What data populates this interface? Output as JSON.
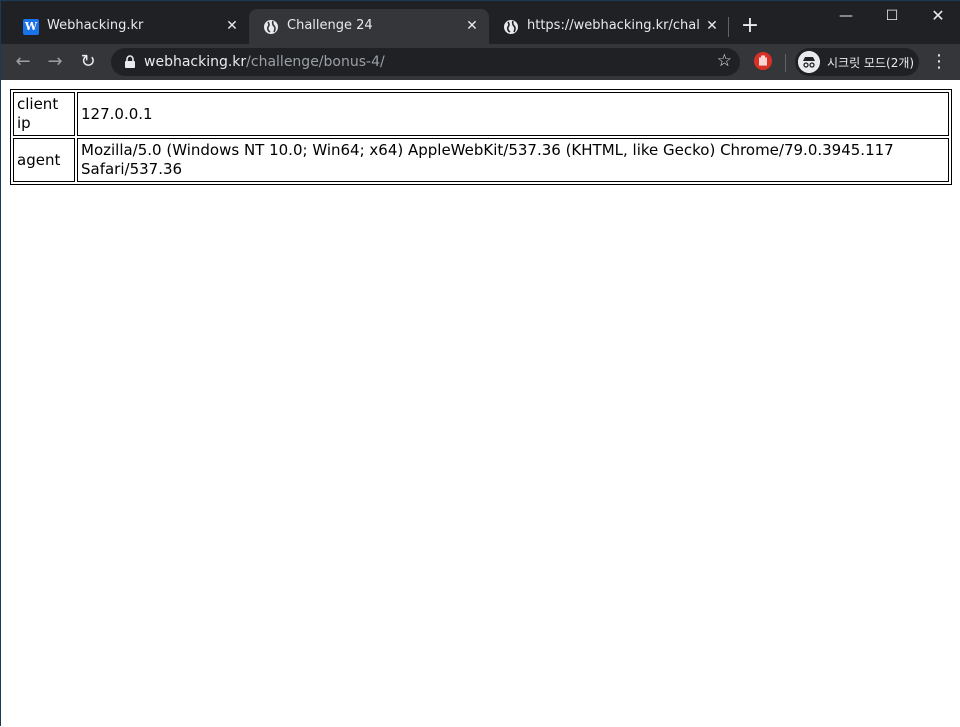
{
  "browser": {
    "tabs": [
      {
        "title": "Webhacking.kr",
        "favicon": "W",
        "active": false
      },
      {
        "title": "Challenge 24",
        "favicon": "globe-icon",
        "active": true
      },
      {
        "title": "https://webhacking.kr/challenge",
        "favicon": "globe-icon",
        "active": false
      }
    ],
    "url_host": "webhacking.kr",
    "url_path": "/challenge/bonus-4/",
    "profile_label": "시크릿 모드(2개)",
    "colors": {
      "tabstrip": "#202124",
      "toolbar": "#35363a",
      "text": "#e8eaed",
      "extension": "#d93025"
    }
  },
  "page": {
    "rows": [
      {
        "key": "client ip",
        "value": "127.0.0.1"
      },
      {
        "key": "agent",
        "value": "Mozilla/5.0 (Windows NT 10.0; Win64; x64) AppleWebKit/537.36 (KHTML, like Gecko) Chrome/79.0.3945.117 Safari/537.36"
      }
    ]
  }
}
